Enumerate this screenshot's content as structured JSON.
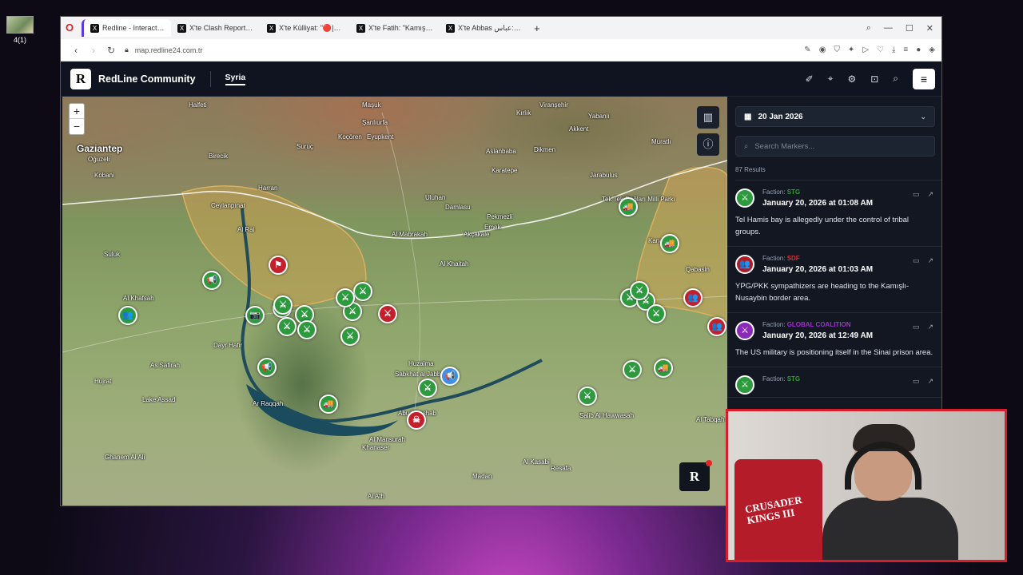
{
  "desktop": {
    "icon_label": "4(1)"
  },
  "browser": {
    "tabs": [
      {
        "label": "Redline - Interactive Strategic",
        "active": true
      },
      {
        "label": "X'te Clash Report: \"The Sy",
        "active": false
      },
      {
        "label": "X'te Külliyat: \"🔴|#SONDA",
        "active": false
      },
      {
        "label": "X'te Fatih: \"Kamışlı'da topl",
        "active": false
      },
      {
        "label": "X'te Abbas عباس: \"SDF's w",
        "active": false
      }
    ],
    "url": "map.redline24.com.tr"
  },
  "app": {
    "brand": "RedLine Community",
    "region_tab": "Syria",
    "header_icons": [
      "route-icon",
      "pin-icon",
      "gear-icon",
      "camera-icon",
      "search-icon"
    ],
    "menu_icon": "≡"
  },
  "map": {
    "zoom_in": "+",
    "zoom_out": "−",
    "places": [
      {
        "name": "Halfeti"
      },
      {
        "name": "Maşuk"
      },
      {
        "name": "Şanlıurfa"
      },
      {
        "name": "Viranşehir"
      },
      {
        "name": "Gaziantep",
        "big": true
      },
      {
        "name": "Birecik"
      },
      {
        "name": "Suruç"
      },
      {
        "name": "Koçören"
      },
      {
        "name": "Eyupkent"
      },
      {
        "name": "Kırlık"
      },
      {
        "name": "Yabanlı"
      },
      {
        "name": "Akkent"
      },
      {
        "name": "Oğuzeli"
      },
      {
        "name": "Kobani"
      },
      {
        "name": "Harran"
      },
      {
        "name": "Uluhan"
      },
      {
        "name": "Karatepe"
      },
      {
        "name": "Aslanbaba"
      },
      {
        "name": "Dikmen"
      },
      {
        "name": "Muratlı"
      },
      {
        "name": "Jarabulus"
      },
      {
        "name": "Ceylanpınar"
      },
      {
        "name": "Tek Tek Dağları Milli Parkı"
      },
      {
        "name": "Damlasu"
      },
      {
        "name": "Pekmezli"
      },
      {
        "name": "Emek"
      },
      {
        "name": "Akçakale"
      },
      {
        "name": "Al Mabrakah"
      },
      {
        "name": "Kanaja"
      },
      {
        "name": "Al Rai"
      },
      {
        "name": "Suluk"
      },
      {
        "name": "Al Khaitah"
      },
      {
        "name": "Qabasin"
      },
      {
        "name": "Al Khafsah"
      },
      {
        "name": "Dayr Hafir"
      },
      {
        "name": "As Safirah"
      },
      {
        "name": "Hujrat"
      },
      {
        "name": "Huzaima"
      },
      {
        "name": "Sabkhat al Jabbul"
      },
      {
        "name": "Lake Assad"
      },
      {
        "name": "Ar Raqqah"
      },
      {
        "name": "Abu Khashab"
      },
      {
        "name": "Salib Al Hawwasah"
      },
      {
        "name": "Al Tabqah"
      },
      {
        "name": "Al Mansurah"
      },
      {
        "name": "Khanaser"
      },
      {
        "name": "Ghanem Al Ali"
      },
      {
        "name": "Madan"
      },
      {
        "name": "Al Kasabi"
      },
      {
        "name": "Resafa"
      },
      {
        "name": "Al Ath"
      }
    ],
    "markers": [
      {
        "kind": "g",
        "glyph": "⚔"
      },
      {
        "kind": "g",
        "glyph": "⚔"
      },
      {
        "kind": "r",
        "glyph": "⚑"
      },
      {
        "kind": "g",
        "glyph": "📢"
      },
      {
        "kind": "g",
        "glyph": "👥"
      },
      {
        "kind": "g",
        "glyph": "📷"
      },
      {
        "kind": "g",
        "glyph": "⚔"
      },
      {
        "kind": "g",
        "glyph": "⚔"
      },
      {
        "kind": "g",
        "glyph": "⚔"
      },
      {
        "kind": "g",
        "glyph": "⚔"
      },
      {
        "kind": "g",
        "glyph": "⚔"
      },
      {
        "kind": "g",
        "glyph": "⚔"
      },
      {
        "kind": "g",
        "glyph": "⚔"
      },
      {
        "kind": "r",
        "glyph": "⚔"
      },
      {
        "kind": "g",
        "glyph": "📢"
      },
      {
        "kind": "b",
        "glyph": "📢"
      },
      {
        "kind": "g",
        "glyph": "⚔"
      },
      {
        "kind": "g",
        "glyph": "🚚"
      },
      {
        "kind": "r",
        "glyph": "☠"
      },
      {
        "kind": "g",
        "glyph": "⚔"
      },
      {
        "kind": "g",
        "glyph": "🚚"
      },
      {
        "kind": "g",
        "glyph": "🚚"
      },
      {
        "kind": "g",
        "glyph": "⚔"
      },
      {
        "kind": "g",
        "glyph": "⚔"
      },
      {
        "kind": "g",
        "glyph": "⚔"
      },
      {
        "kind": "r",
        "glyph": "👥"
      },
      {
        "kind": "r",
        "glyph": "👥"
      },
      {
        "kind": "g",
        "glyph": "⚔"
      },
      {
        "kind": "g",
        "glyph": "🚚"
      },
      {
        "kind": "g",
        "glyph": "⚔"
      }
    ],
    "fab_label": "R"
  },
  "panel": {
    "date": "20 Jan 2026",
    "search_placeholder": "Search Markers...",
    "results": "87 Results",
    "cards": [
      {
        "faction_prefix": "Faction: ",
        "faction": "STG",
        "faction_color": "#2e9a3e",
        "when": "January 20, 2026 at 01:08 AM",
        "text": "Tel Hamis bay is allegedly under the control of tribal groups.",
        "avatar_color": "#2e9a3e",
        "avatar_glyph": "⚔"
      },
      {
        "faction_prefix": "Faction: ",
        "faction": "SDF",
        "faction_color": "#d0303a",
        "when": "January 20, 2026 at 01:03 AM",
        "text": "YPG/PKK sympathizers are heading to the Kamışlı-Nusaybin border area.",
        "avatar_color": "#b01d28",
        "avatar_glyph": "👥"
      },
      {
        "faction_prefix": "Faction: ",
        "faction": "GLOBAL COALITION",
        "faction_color": "#a030d0",
        "when": "January 20, 2026 at 12:49 AM",
        "text": "The US military is positioning itself in the Sinai prison area.",
        "avatar_color": "#8a2ab8",
        "avatar_glyph": "⚔"
      },
      {
        "faction_prefix": "Faction: ",
        "faction": "STG",
        "faction_color": "#2e9a3e",
        "when": "",
        "text": "",
        "avatar_color": "#2e9a3e",
        "avatar_glyph": "⚔"
      }
    ]
  },
  "webcam": {
    "chair_text": "CRUSADER KINGS III"
  }
}
